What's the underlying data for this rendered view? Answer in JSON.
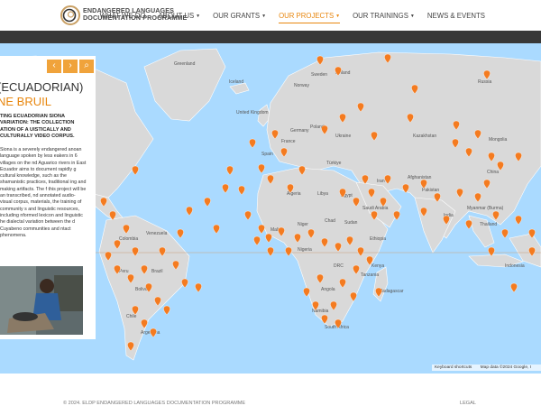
{
  "header": {
    "logo_line1": "ENDANGERED LANGUAGES",
    "logo_line2": "DOCUMENTATION PROGRAMME",
    "logo_icon": "elp-ring-logo"
  },
  "nav": [
    {
      "label": "WHAT WE DO",
      "dropdown": false,
      "active": false
    },
    {
      "label": "ABOUT US",
      "dropdown": true,
      "active": false
    },
    {
      "label": "OUR GRANTS",
      "dropdown": true,
      "active": false
    },
    {
      "label": "OUR PROJECTS",
      "dropdown": true,
      "active": true
    },
    {
      "label": "OUR TRAININGS",
      "dropdown": true,
      "active": false
    },
    {
      "label": "NEWS & EVENTS",
      "dropdown": false,
      "active": false
    }
  ],
  "panel": {
    "title": "(ECUADORIAN)",
    "subtitle": "NE BRUIL",
    "controls": [
      "‹",
      "›",
      "⌕"
    ],
    "heading": "TING ECUADORIAN SIONA VARIATION: THE COLLECTION ATION OF A UISTICALLY AND CULTURALLY VIDEO CORPUS.",
    "body": "Siona is a severely endangered anoan language spoken by less eakers in 6 villages on the nd Aguarico rivers in East Ecuador aims to document rapidly g cultural knowledge, such as the shamanistic practices, traditional ing and making artifacts. The f this project will be an transcribed, nd annotated audio-visual corpus, materials, the training of community s and linguistic resources, including nformed lexicon and linguistic he dialectal variation between the d Cuyabeno communities and ntact phenomena."
  },
  "map": {
    "labels": [
      "Greenland",
      "Iceland",
      "Sweden",
      "Finland",
      "Norway",
      "Russia",
      "United Kingdom",
      "Poland",
      "Germany",
      "Ukraine",
      "France",
      "Spain",
      "Kazakhstan",
      "Mongolia",
      "Türkiye",
      "Iran",
      "China",
      "Afghanistan",
      "Pakistan",
      "Algeria",
      "Libya",
      "Egypt",
      "Saudi Arabia",
      "India",
      "Myanmar (Burma)",
      "Thailand",
      "Mali",
      "Niger",
      "Chad",
      "Sudan",
      "Ethiopia",
      "Nigeria",
      "Kenya",
      "DRC",
      "Tanzania",
      "Angola",
      "Namibia",
      "South Africa",
      "Madagascar",
      "Indonesia",
      "Colombia",
      "Peru",
      "Brazil",
      "Bolivia",
      "Chile",
      "Argentina",
      "Venezuela"
    ],
    "attribution_shortcuts": "Keyboard shortcuts",
    "attribution_data": "Map data ©2024 Google, I",
    "land_color": "#d9d9d9",
    "water_color": "#aadaff",
    "marker_color": "#f47b20"
  },
  "footer": {
    "copyright": "© 2024. ELDP ENDANGERED LANGUAGES DOCUMENTATION PROGRAMME",
    "link": "LEGAL"
  }
}
